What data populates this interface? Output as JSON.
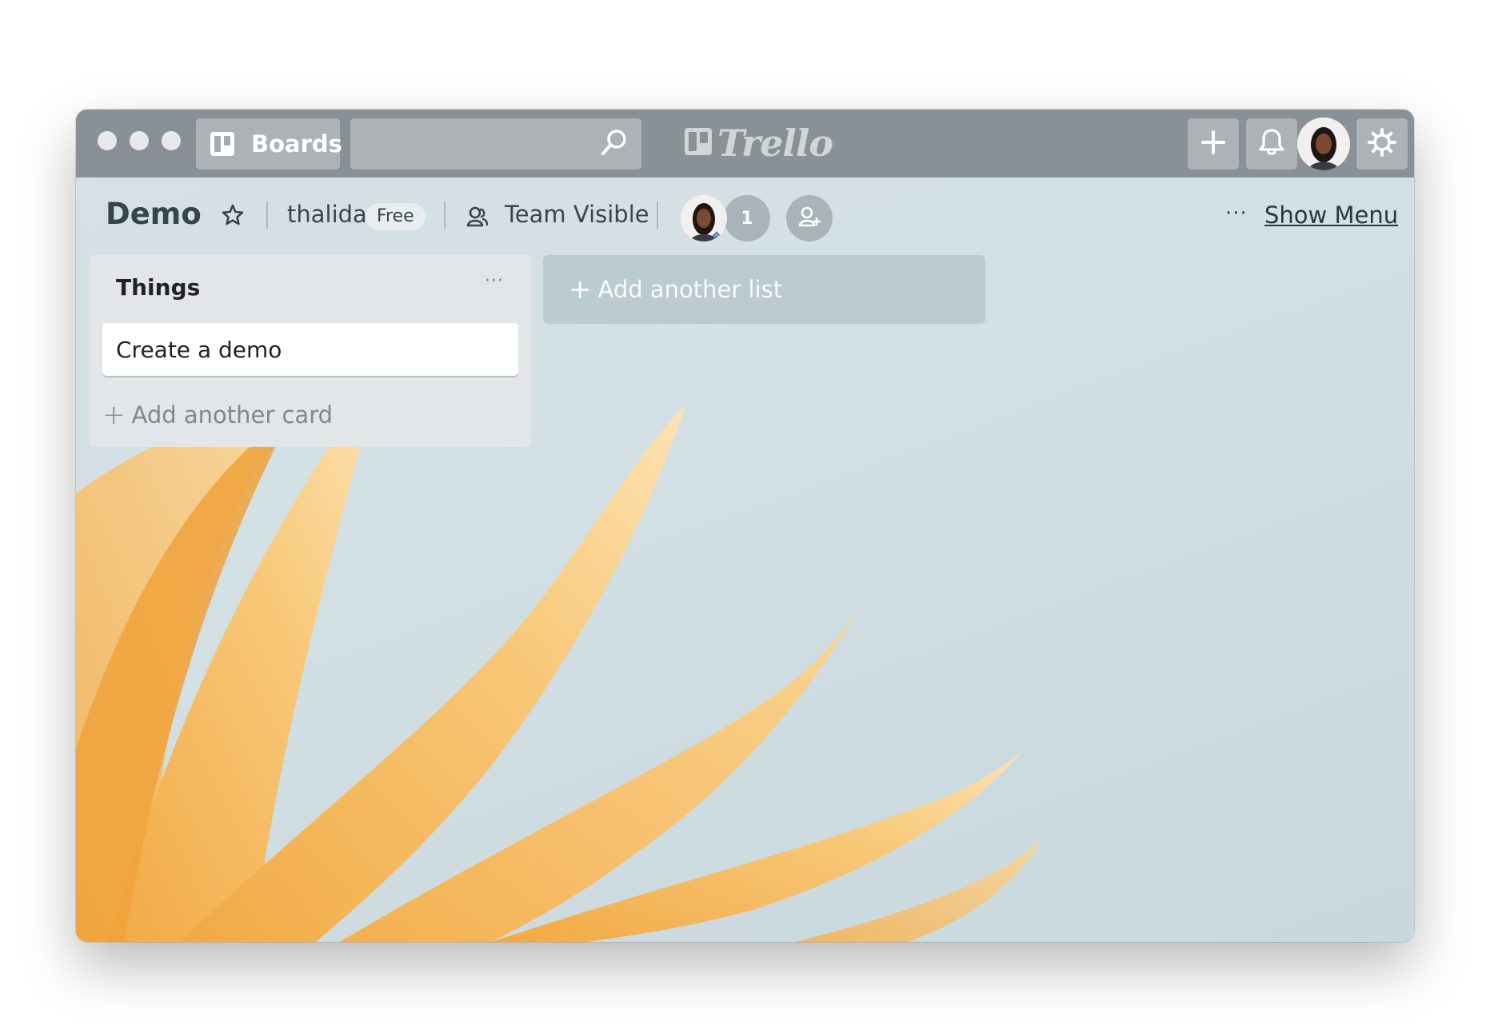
{
  "topbar": {
    "boards_label": "Boards",
    "search_value": "",
    "logo_text": "Trello",
    "icons": [
      "board-icon",
      "search-icon",
      "trello-logo-icon",
      "plus-icon",
      "bell-icon",
      "avatar",
      "gear-icon"
    ]
  },
  "board": {
    "title": "Demo",
    "owner": "thalida",
    "plan_badge": "Free",
    "visibility": "Team Visible",
    "member_count": "1",
    "menu_dots": "···",
    "show_menu_label": "Show Menu"
  },
  "lists": [
    {
      "title": "Things",
      "menu": "···",
      "cards": [
        "Create a demo"
      ],
      "add_card_label": "Add another card"
    }
  ],
  "add_list_label": "Add another list",
  "colors": {
    "topbar": "#889195",
    "background": "#d3dfe3",
    "petal": "#f6c06a",
    "list_bg": "#e3e6e8"
  }
}
